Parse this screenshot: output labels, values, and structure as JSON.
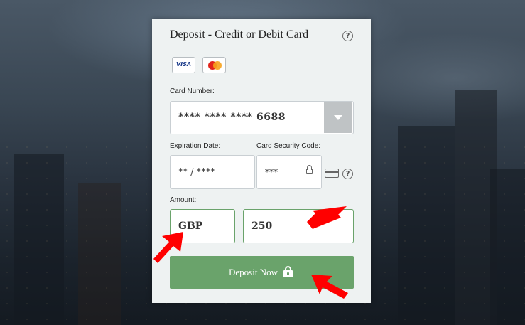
{
  "panel": {
    "title": "Deposit - Credit or Debit Card",
    "help_glyph": "?"
  },
  "card_brands": [
    {
      "name": "visa-logo",
      "text": "VISA"
    },
    {
      "name": "mastercard-logo",
      "text": ""
    }
  ],
  "card_number": {
    "label": "Card Number:",
    "value": "**** **** **** 6688"
  },
  "expiration": {
    "label": "Expiration Date:",
    "value": "** / ****"
  },
  "security_code": {
    "label": "Card Security Code:",
    "value": "***"
  },
  "amount": {
    "label": "Amount:",
    "currency": "GBP",
    "value": "250"
  },
  "submit": {
    "label": "Deposit Now"
  },
  "colors": {
    "accent": "#6aa36b",
    "panel_bg": "#eef2f2",
    "annotation_arrow": "#ff0000",
    "visa_blue": "#1a3a8a",
    "mc_red": "#e2231a",
    "mc_orange": "#f7a21b"
  },
  "icons": [
    "help-icon",
    "lock-icon",
    "credit-card-icon",
    "chevron-down-icon",
    "red-annotation-arrow"
  ]
}
